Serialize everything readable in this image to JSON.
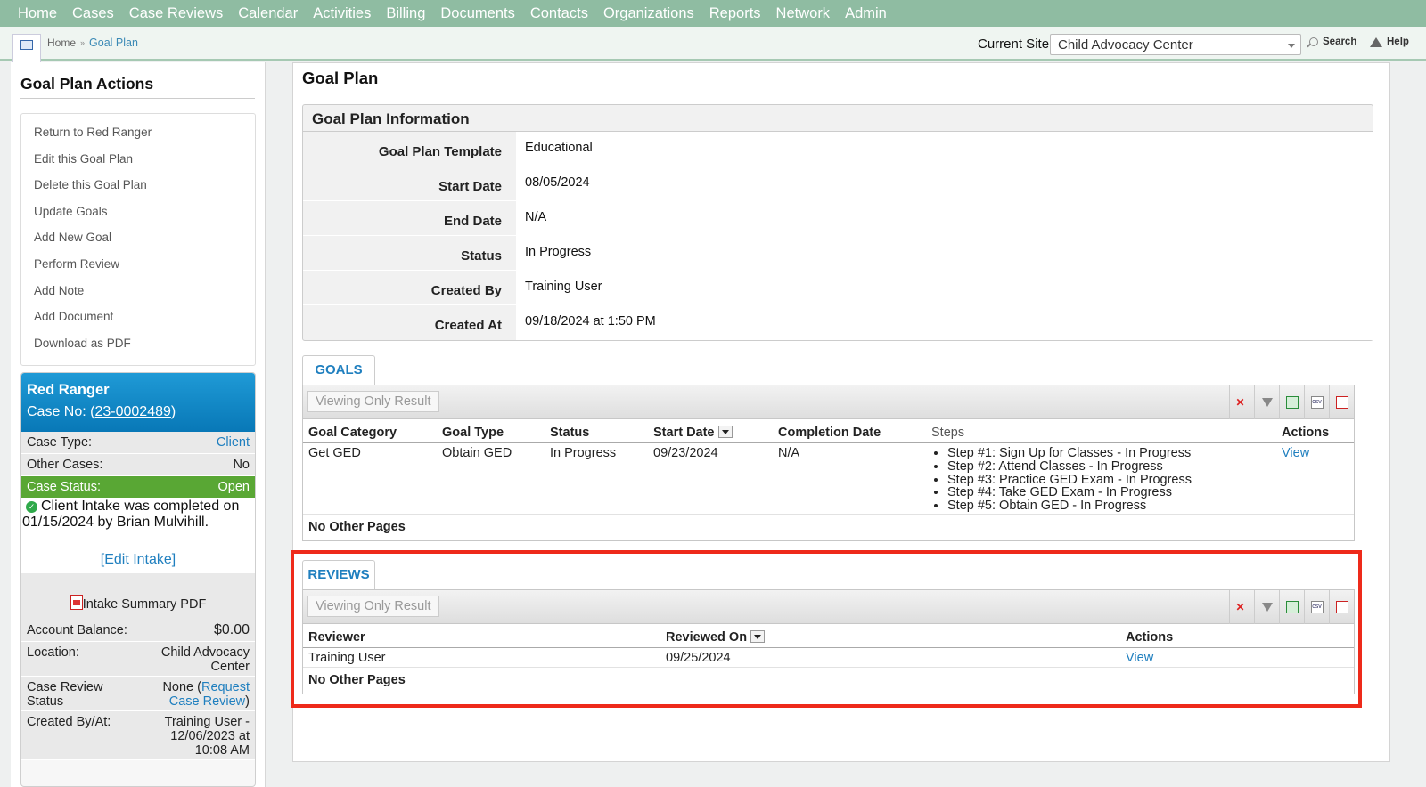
{
  "nav": [
    "Home",
    "Cases",
    "Case Reviews",
    "Calendar",
    "Activities",
    "Billing",
    "Documents",
    "Contacts",
    "Organizations",
    "Reports",
    "Network",
    "Admin"
  ],
  "breadcrumb": {
    "home": "Home",
    "sep": "»",
    "current": "Goal Plan"
  },
  "site": {
    "label": "Current Site",
    "value": "Child Advocacy Center",
    "search": "Search",
    "help": "Help"
  },
  "sidebar": {
    "title": "Goal Plan Actions",
    "actions": [
      "Return to Red Ranger",
      "Edit this Goal Plan",
      "Delete this Goal Plan",
      "Update Goals",
      "Add New Goal",
      "Perform Review",
      "Add Note",
      "Add Document",
      "Download as PDF"
    ]
  },
  "client": {
    "name": "Red Ranger",
    "case_prefix": "Case No: (",
    "case_no": "23-0002489",
    "case_suffix": ")",
    "case_type_label": "Case Type:",
    "case_type": "Client",
    "other_cases_label": "Other Cases:",
    "other_cases": "No",
    "status_label": "Case Status:",
    "status": "Open",
    "intake_note": "Client Intake was completed on 01/15/2024 by Brian Mulvihill.",
    "edit_intake": "[Edit Intake]",
    "intake_pdf": "Intake Summary PDF",
    "balance_label": "Account Balance:",
    "balance": "$0.00",
    "location_label": "Location:",
    "location": "Child Advocacy Center",
    "review_label": "Case Review Status",
    "review_value": "None (",
    "review_link": "Request Case Review",
    "review_close": ")",
    "created_label": "Created By/At:",
    "created": "Training User - 12/06/2023 at 10:08 AM"
  },
  "page": {
    "title": "Goal Plan",
    "info_title": "Goal Plan Information",
    "info": [
      {
        "label": "Goal Plan Template",
        "value": "Educational"
      },
      {
        "label": "Start Date",
        "value": "08/05/2024"
      },
      {
        "label": "End Date",
        "value": "N/A"
      },
      {
        "label": "Status",
        "value": "In Progress"
      },
      {
        "label": "Created By",
        "value": "Training User"
      },
      {
        "label": "Created At",
        "value": "09/18/2024 at 1:50 PM"
      }
    ]
  },
  "goals": {
    "tab": "GOALS",
    "viewing": "Viewing Only Result",
    "headers": [
      "Goal Category",
      "Goal Type",
      "Status",
      "Start Date",
      "Completion Date",
      "Steps",
      "Actions"
    ],
    "row": {
      "category": "Get GED",
      "type": "Obtain GED",
      "status": "In Progress",
      "start": "09/23/2024",
      "completion": "N/A",
      "steps": [
        "Step #1: Sign Up for Classes - In Progress",
        "Step #2: Attend Classes - In Progress",
        "Step #3: Practice GED Exam - In Progress",
        "Step #4: Take GED Exam - In Progress",
        "Step #5: Obtain GED - In Progress"
      ],
      "action": "View"
    },
    "footer": "No Other Pages"
  },
  "reviews": {
    "tab": "REVIEWS",
    "viewing": "Viewing Only Result",
    "headers": [
      "Reviewer",
      "Reviewed On",
      "Actions"
    ],
    "row": {
      "reviewer": "Training User",
      "reviewed_on": "09/25/2024",
      "action": "View"
    },
    "footer": "No Other Pages"
  },
  "toolbar_icons": [
    "clear-filter-icon",
    "filter-icon",
    "excel-export-icon",
    "csv-export-icon",
    "pdf-export-icon"
  ],
  "colors": {
    "nav_bg": "#8fbca2",
    "link": "#1f7fbf",
    "client_header": "#1689c9",
    "status_green": "#59a734",
    "highlight": "#ee2a1a"
  }
}
